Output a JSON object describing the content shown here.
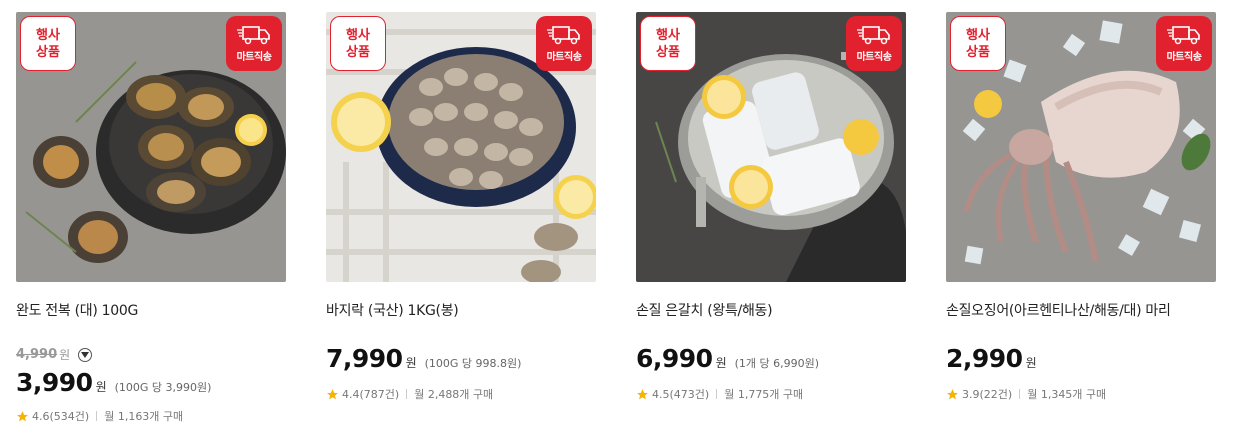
{
  "products": [
    {
      "title": "완도 전복 (대) 100G",
      "event_badge": [
        "행사",
        "상품"
      ],
      "delivery_badge": "마트직송",
      "original_price": "4,990",
      "original_unit": "원",
      "price": "3,990",
      "currency": "원",
      "unit_price": "(100G 당 3,990원)",
      "rating": "4.6",
      "reviews": "(534건)",
      "monthly": "월 1,163개 구매"
    },
    {
      "title": "바지락 (국산) 1KG(봉)",
      "event_badge": [
        "행사",
        "상품"
      ],
      "delivery_badge": "마트직송",
      "price": "7,990",
      "currency": "원",
      "unit_price": "(100G 당 998.8원)",
      "rating": "4.4",
      "reviews": "(787건)",
      "monthly": "월 2,488개 구매"
    },
    {
      "title": "손질 은갈치 (왕특/해동)",
      "event_badge": [
        "행사",
        "상품"
      ],
      "delivery_badge": "마트직송",
      "price": "6,990",
      "currency": "원",
      "unit_price": "(1개 당 6,990원)",
      "rating": "4.5",
      "reviews": "(473건)",
      "monthly": "월 1,775개 구매"
    },
    {
      "title": "손질오징어(아르헨티나산/해동/대) 마리",
      "event_badge": [
        "행사",
        "상품"
      ],
      "delivery_badge": "마트직송",
      "price": "2,990",
      "currency": "원",
      "unit_price": "",
      "rating": "3.9",
      "reviews": "(22건)",
      "monthly": "월 1,345개 구매"
    }
  ],
  "colors": {
    "badge_red": "#e2212e",
    "star": "#f5b400"
  },
  "icons": {
    "delivery": "truck-icon",
    "rating": "star-icon",
    "toggle": "chevron-down-icon"
  }
}
